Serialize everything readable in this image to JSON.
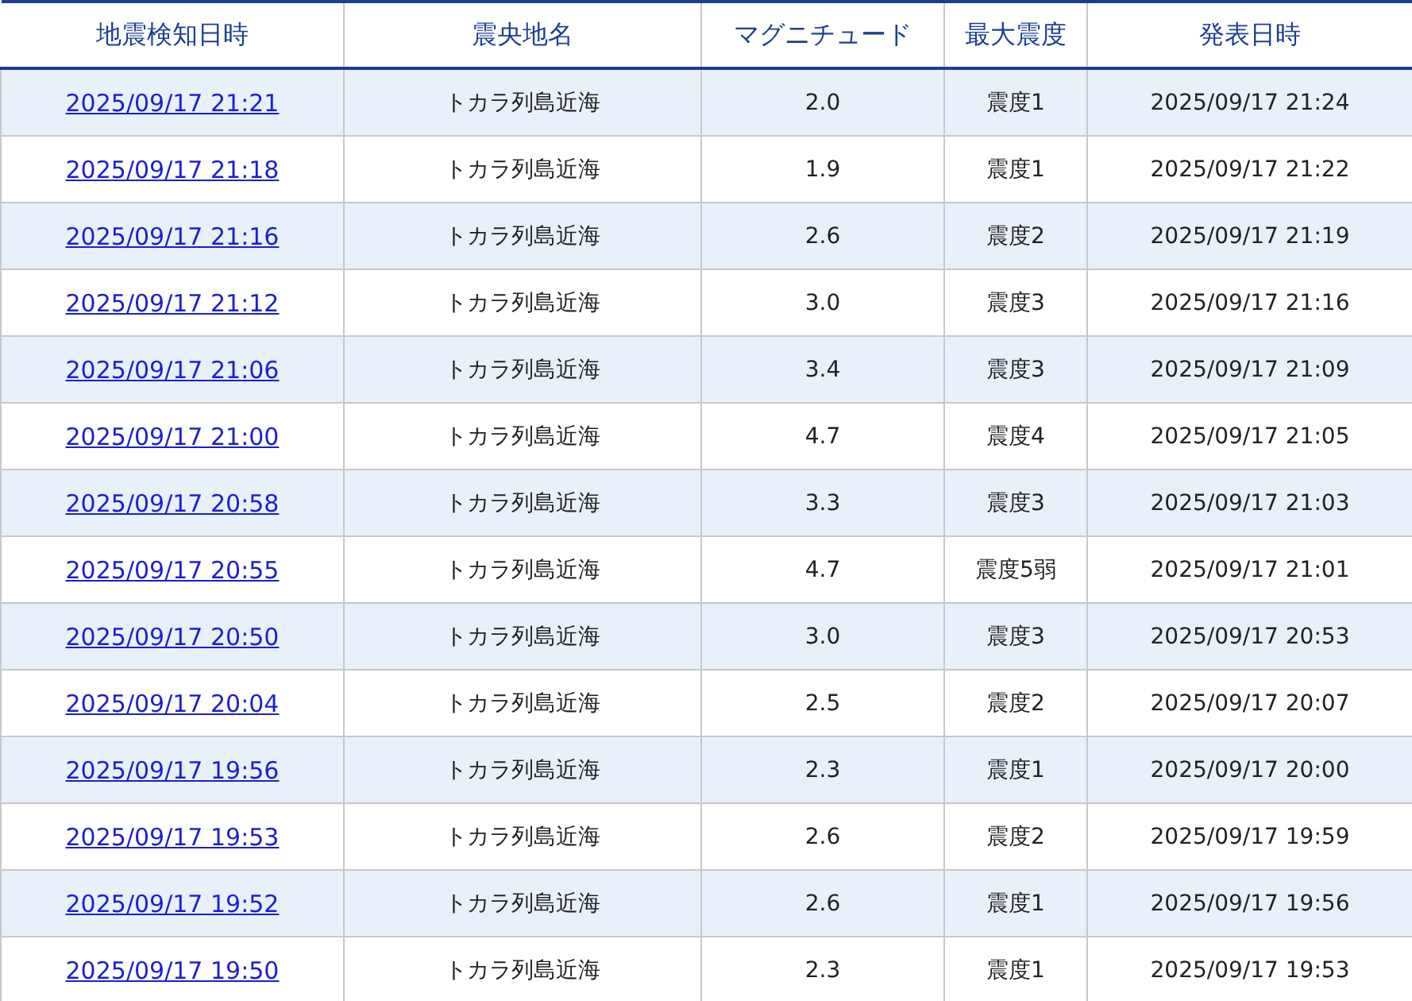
{
  "table": {
    "columns": [
      "地震検知日時",
      "震央地名",
      "マグニチュード",
      "最大震度",
      "発表日時"
    ],
    "rows": [
      [
        "2025/09/17 21:21",
        "トカラ列島近海",
        "2.0",
        "震度1",
        "2025/09/17 21:24"
      ],
      [
        "2025/09/17 21:18",
        "トカラ列島近海",
        "1.9",
        "震度1",
        "2025/09/17 21:22"
      ],
      [
        "2025/09/17 21:16",
        "トカラ列島近海",
        "2.6",
        "震度2",
        "2025/09/17 21:19"
      ],
      [
        "2025/09/17 21:12",
        "トカラ列島近海",
        "3.0",
        "震度3",
        "2025/09/17 21:16"
      ],
      [
        "2025/09/17 21:06",
        "トカラ列島近海",
        "3.4",
        "震度3",
        "2025/09/17 21:09"
      ],
      [
        "2025/09/17 21:00",
        "トカラ列島近海",
        "4.7",
        "震度4",
        "2025/09/17 21:05"
      ],
      [
        "2025/09/17 20:58",
        "トカラ列島近海",
        "3.3",
        "震度3",
        "2025/09/17 21:03"
      ],
      [
        "2025/09/17 20:55",
        "トカラ列島近海",
        "4.7",
        "震度5弱",
        "2025/09/17 21:01"
      ],
      [
        "2025/09/17 20:50",
        "トカラ列島近海",
        "3.0",
        "震度3",
        "2025/09/17 20:53"
      ],
      [
        "2025/09/17 20:04",
        "トカラ列島近海",
        "2.5",
        "震度2",
        "2025/09/17 20:07"
      ],
      [
        "2025/09/17 19:56",
        "トカラ列島近海",
        "2.3",
        "震度1",
        "2025/09/17 20:00"
      ],
      [
        "2025/09/17 19:53",
        "トカラ列島近海",
        "2.6",
        "震度2",
        "2025/09/17 19:59"
      ],
      [
        "2025/09/17 19:52",
        "トカラ列島近海",
        "2.6",
        "震度1",
        "2025/09/17 19:56"
      ],
      [
        "2025/09/17 19:50",
        "トカラ列島近海",
        "2.3",
        "震度1",
        "2025/09/17 19:53"
      ]
    ]
  }
}
